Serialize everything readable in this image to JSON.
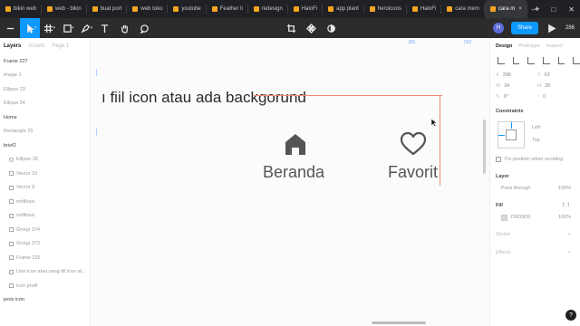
{
  "browser_tabs": [
    {
      "label": "bikin web",
      "active": false
    },
    {
      "label": "web - bikin",
      "active": false
    },
    {
      "label": "buat port",
      "active": false
    },
    {
      "label": "web toko",
      "active": false
    },
    {
      "label": "youtube",
      "active": false
    },
    {
      "label": "Feather li",
      "active": false
    },
    {
      "label": "redesign",
      "active": false
    },
    {
      "label": "HaloFi",
      "active": false
    },
    {
      "label": "app plant",
      "active": false
    },
    {
      "label": "heroicons",
      "active": false
    },
    {
      "label": "HaloFi",
      "active": false
    },
    {
      "label": "cara mem",
      "active": false
    },
    {
      "label": "cara m",
      "active": true
    }
  ],
  "newtab_label": "+",
  "window_controls": {
    "minimize": "—",
    "maximize": "□",
    "close": "✕"
  },
  "toolbar": {
    "share_label": "Share",
    "avatar_initial": "H",
    "zoom": "286"
  },
  "left_panel": {
    "tabs": [
      "Layers",
      "Assets"
    ],
    "page_label": "Page 1",
    "layers": [
      {
        "label": "Frame 227",
        "style": "strong"
      },
      {
        "label": "image 1",
        "style": "normal"
      },
      {
        "label": "Ellipse 23",
        "style": "normal"
      },
      {
        "label": "Ellipse 24",
        "style": "normal"
      },
      {
        "label": "Home",
        "style": "strong"
      },
      {
        "label": "Rectangle 25",
        "style": "normal"
      },
      {
        "label": "brief2",
        "style": "strong"
      },
      {
        "label": "Ellipse 28",
        "style": "indent"
      },
      {
        "label": "Vector 10",
        "style": "indent"
      },
      {
        "label": "Vector 9",
        "style": "indent"
      },
      {
        "label": "notfikasi",
        "style": "indent"
      },
      {
        "label": "notfikasi",
        "style": "indent"
      },
      {
        "label": "Group 374",
        "style": "indent"
      },
      {
        "label": "Group 373",
        "style": "indent"
      },
      {
        "label": "Frame 226",
        "style": "indent"
      },
      {
        "label": "Line icon atau yang fiil icon at...",
        "style": "indent"
      },
      {
        "label": "icon profil",
        "style": "indent"
      },
      {
        "label": "jenis icon",
        "style": "strong"
      }
    ]
  },
  "canvas": {
    "heading": "ı fiil icon atau ada backgorund",
    "items": [
      {
        "label": "Beranda",
        "icon": "home-icon"
      },
      {
        "label": "Favorit",
        "icon": "heart-icon"
      }
    ],
    "ruler_values": [
      "386",
      "582"
    ],
    "selection_color": "#f08a73"
  },
  "right_panel": {
    "tabs": [
      "Design",
      "Prototype",
      "Inspect"
    ],
    "props": [
      {
        "k": "X",
        "v": "398"
      },
      {
        "k": "Y",
        "v": "62"
      },
      {
        "k": "W",
        "v": "34"
      },
      {
        "k": "H",
        "v": "28"
      },
      {
        "k": "↻",
        "v": "0°"
      },
      {
        "k": "◜",
        "v": "0"
      }
    ],
    "constraints_title": "Constraints",
    "constraint_h": "Left",
    "constraint_v": "Top",
    "fix_position": "Fix position when scrolling",
    "layer_title": "Layer",
    "blend_mode": "Pass through",
    "layer_opacity": "100%",
    "fill_title": "Fill",
    "fill_hex": "D9D9D9",
    "fill_opacity": "100%",
    "fill_color": "#d9d9d9",
    "stroke_title": "Stroke",
    "effects_title": "Effects",
    "help_label": "?"
  }
}
